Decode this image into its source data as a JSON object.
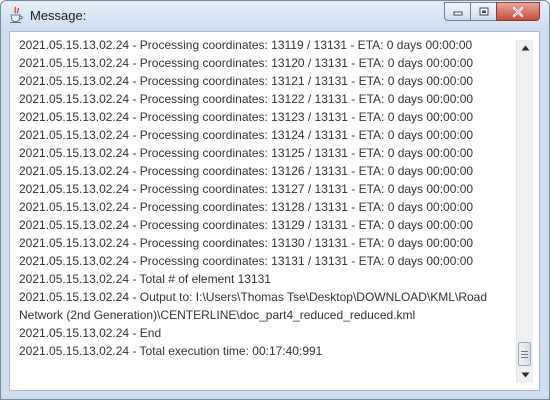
{
  "window": {
    "title": "Message:",
    "icons": {
      "app": "java-cup-icon",
      "minimize": "minimize-icon",
      "maximize": "maximize-icon",
      "close": "close-icon"
    }
  },
  "log": {
    "lines": [
      "2021.05.15.13.02.24 - Processing coordinates: 13119 / 13131 - ETA: 0 days 00:00:00",
      "2021.05.15.13.02.24 - Processing coordinates: 13120 / 13131 - ETA: 0 days 00:00:00",
      "2021.05.15.13.02.24 - Processing coordinates: 13121 / 13131 - ETA: 0 days 00:00:00",
      "2021.05.15.13.02.24 - Processing coordinates: 13122 / 13131 - ETA: 0 days 00:00:00",
      "2021.05.15.13.02.24 - Processing coordinates: 13123 / 13131 - ETA: 0 days 00:00:00",
      "2021.05.15.13.02.24 - Processing coordinates: 13124 / 13131 - ETA: 0 days 00:00:00",
      "2021.05.15.13.02.24 - Processing coordinates: 13125 / 13131 - ETA: 0 days 00:00:00",
      "2021.05.15.13.02.24 - Processing coordinates: 13126 / 13131 - ETA: 0 days 00:00:00",
      "2021.05.15.13.02.24 - Processing coordinates: 13127 / 13131 - ETA: 0 days 00:00:00",
      "2021.05.15.13.02.24 - Processing coordinates: 13128 / 13131 - ETA: 0 days 00:00:00",
      "2021.05.15.13.02.24 - Processing coordinates: 13129 / 13131 - ETA: 0 days 00:00:00",
      "2021.05.15.13.02.24 - Processing coordinates: 13130 / 13131 - ETA: 0 days 00:00:00",
      "2021.05.15.13.02.24 - Processing coordinates: 13131 / 13131 - ETA: 0 days 00:00:00",
      "2021.05.15.13.02.24 - Total # of element 13131",
      "2021.05.15.13.02.24 - Output to: I:\\Users\\Thomas Tse\\Desktop\\DOWNLOAD\\KML\\Road Network (2nd Generation)\\CENTERLINE\\doc_part4_reduced_reduced.kml",
      "2021.05.15.13.02.24 - End",
      "2021.05.15.13.02.24 - Total execution time: 00:17:40:991"
    ]
  },
  "scrollbar": {
    "icons": {
      "up": "scroll-up-arrow-icon",
      "down": "scroll-down-arrow-icon"
    },
    "scroll_position": 1.0
  }
}
